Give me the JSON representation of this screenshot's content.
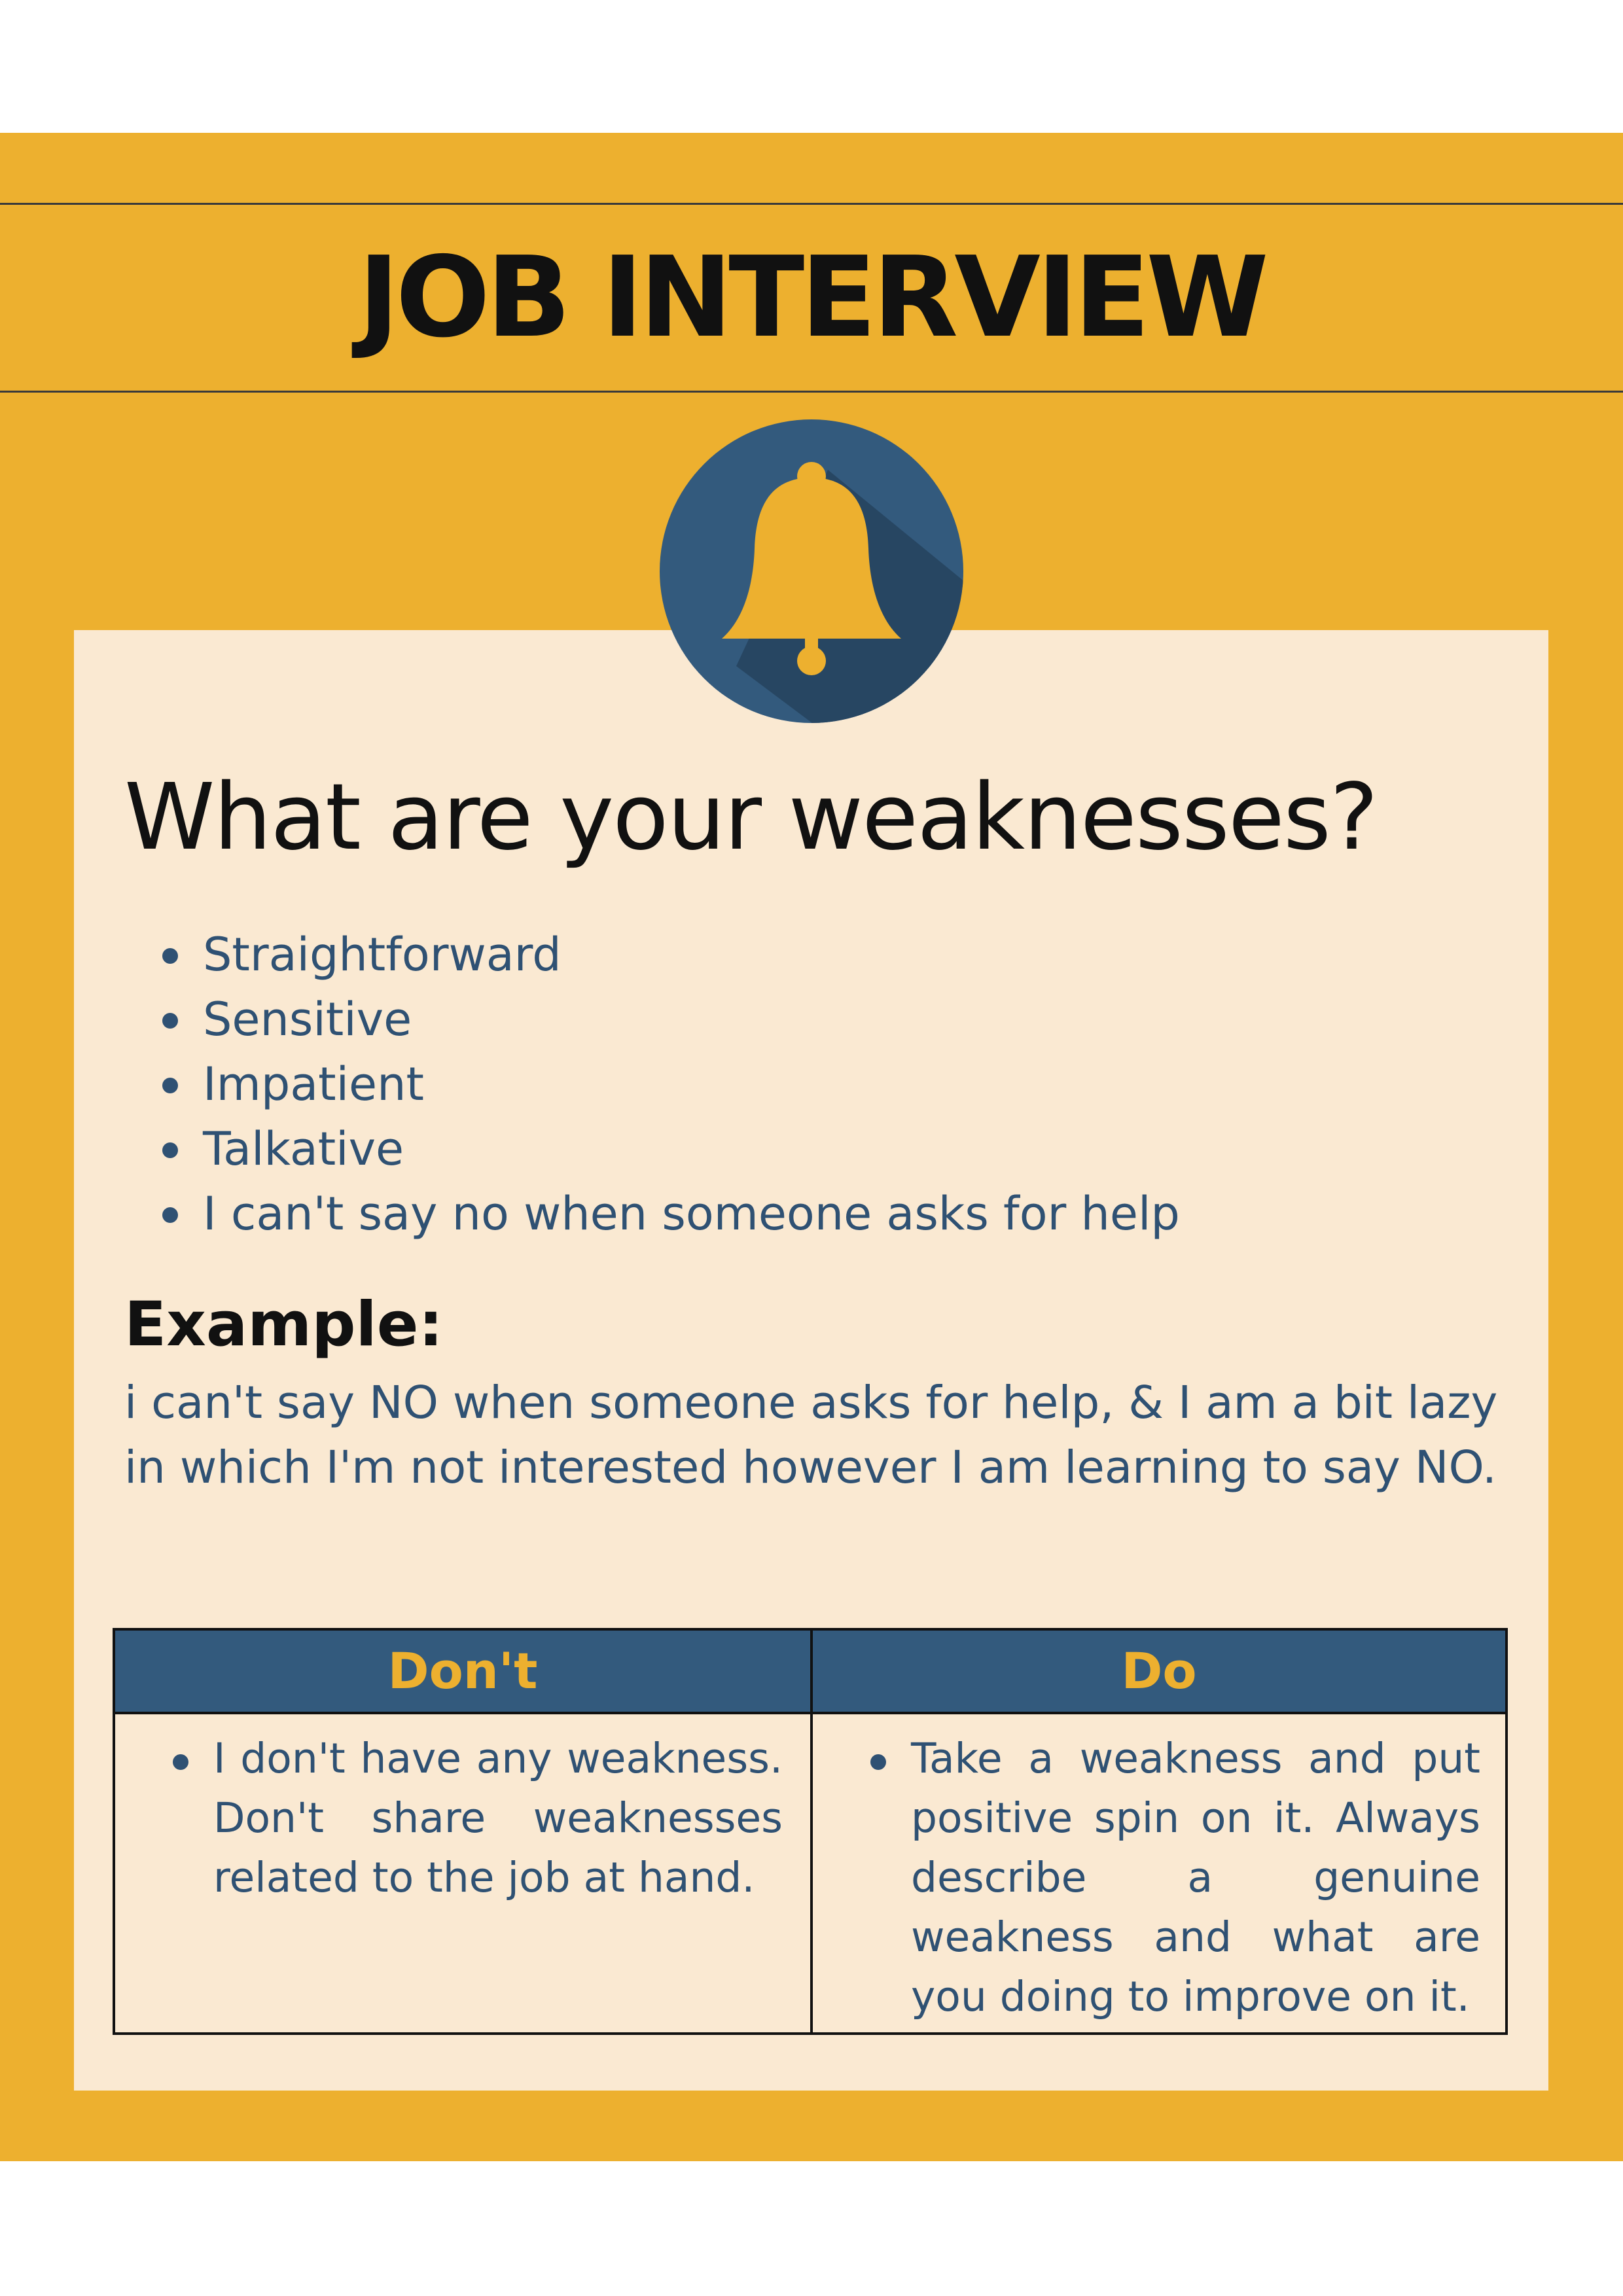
{
  "header": {
    "title": "JOB INTERVIEW"
  },
  "icons": {
    "bell": "bell-icon"
  },
  "colors": {
    "poster_bg": "#EDB02F",
    "card_bg": "#FAE9D2",
    "accent_blue": "#335A7D",
    "text_blue": "#2F5173"
  },
  "card": {
    "question": "What are your weaknesses?",
    "weaknesses": [
      "Straightforward",
      "Sensitive",
      "Impatient",
      "Talkative",
      "I can't say no when someone asks for help"
    ],
    "example_label": "Example:",
    "example_text": "i can't say NO when someone asks for help, & I am a bit lazy in which I'm not interested however I am learning to say NO."
  },
  "table": {
    "dont_header": "Don't",
    "do_header": "Do",
    "dont_items": [
      "I don't have any weakness. Don't share weaknesses related to the job at hand."
    ],
    "do_items": [
      "Take a weakness and put positive spin on it. Always describe a genuine weakness and what are you doing to improve on it."
    ]
  }
}
